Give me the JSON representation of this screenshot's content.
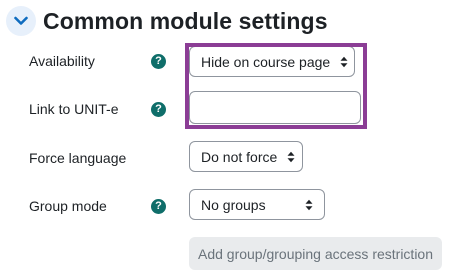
{
  "section": {
    "title": "Common module settings",
    "collapse_icon": "chevron-down-icon"
  },
  "fields": {
    "availability": {
      "label": "Availability",
      "value": "Hide on course page",
      "help_icon": "question-circle-icon"
    },
    "link_unit_e": {
      "label": "Link to UNIT-e",
      "value": "",
      "help_icon": "question-circle-icon"
    },
    "force_language": {
      "label": "Force language",
      "value": "Do not force"
    },
    "group_mode": {
      "label": "Group mode",
      "value": "No groups",
      "help_icon": "question-circle-icon"
    }
  },
  "buttons": {
    "add_restriction": "Add group/grouping access restriction"
  },
  "icons": {
    "help_glyph": "?"
  },
  "colors": {
    "help_icon": "#0f6e6a",
    "highlight": "#8b3d95",
    "collapse_bg": "#e7f0fb",
    "chevron": "#0f6cbf",
    "disabled_bg": "#e9ebed"
  }
}
